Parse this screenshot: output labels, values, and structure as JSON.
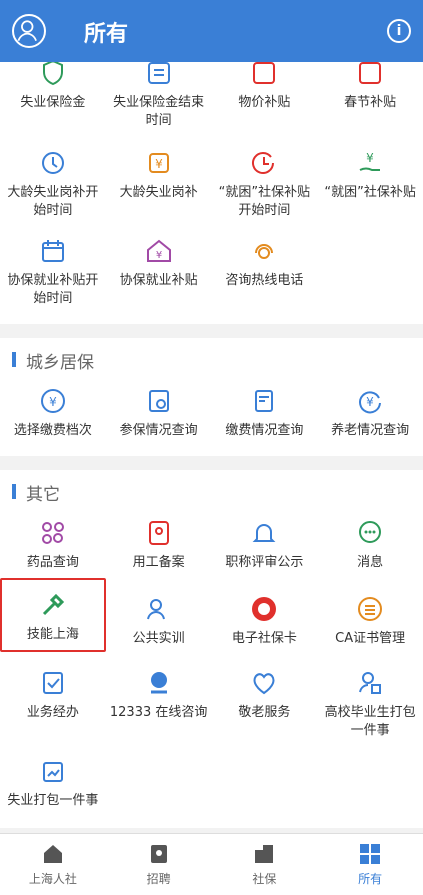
{
  "header": {
    "title": "所有",
    "info_glyph": "i"
  },
  "colors": {
    "brand": "#3a7fd6",
    "highlight": "#e0302c"
  },
  "top_section": {
    "row1": [
      "失业保险金",
      "失业保险金结束时间",
      "物价补贴",
      "春节补贴"
    ],
    "row2": [
      "大龄失业岗补开始时间",
      "大龄失业岗补",
      "“就困”社保补贴开始时间",
      "“就困”社保补贴"
    ],
    "row3": [
      "协保就业补贴开始时间",
      "协保就业补贴",
      "咨询热线电话"
    ]
  },
  "section_urban": {
    "title": "城乡居保",
    "items": [
      "选择缴费档次",
      "参保情况查询",
      "缴费情况查询",
      "养老情况查询"
    ]
  },
  "section_other": {
    "title": "其它",
    "items": [
      "药品查询",
      "用工备案",
      "职称评审公示",
      "消息",
      "技能上海",
      "公共实训",
      "电子社保卡",
      "CA证书管理",
      "业务经办",
      "12333 在线咨询",
      "敬老服务",
      "高校毕业生打包一件事",
      "失业打包一件事"
    ]
  },
  "tabbar": [
    "上海人社",
    "招聘",
    "社保",
    "所有"
  ],
  "tabbar_active": "所有"
}
